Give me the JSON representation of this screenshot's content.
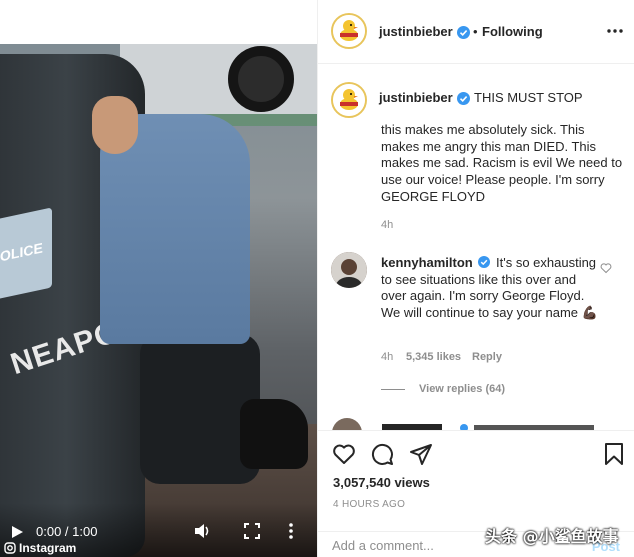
{
  "video": {
    "time": "0:00 / 1:00",
    "credit": "Instagram",
    "door_text": "NEAPOLIS",
    "plate_text": "OLICE"
  },
  "post": {
    "author": "justinbieber",
    "follow_separator": "•",
    "follow_status": "Following",
    "caption_title": "THIS MUST STOP",
    "caption_body": "this makes me absolutely sick. This makes me angry this man DIED. This makes me sad. Racism is evil We need to use our voice! Please people. I'm sorry GEORGE FLOYD",
    "caption_age": "4h"
  },
  "comment": {
    "user": "kennyhamilton",
    "text": "It's so exhausting to see situations like this over and over again. I'm sorry George Floyd. We will continue to say your name 💪🏿",
    "age": "4h",
    "likes": "5,345 likes",
    "reply_label": "Reply",
    "view_replies": "View replies (64)"
  },
  "actions": {
    "views": "3,057,540 views",
    "ago": "4 HOURS AGO",
    "comment_placeholder": "Add a comment...",
    "post_label": "Post"
  },
  "watermark": "头条 @小鲨鱼故事",
  "colors": {
    "verified": "#3897f0",
    "muted": "#8e8e8e",
    "post_disabled": "#b2dffc",
    "avatar_ring": "#e8c55c"
  }
}
